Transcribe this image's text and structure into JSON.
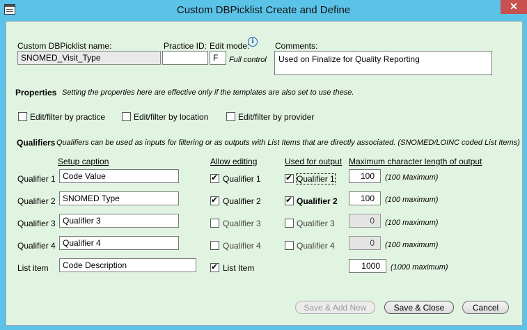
{
  "window": {
    "title": "Custom DBPicklist Create and Define",
    "close_label": "✕"
  },
  "header": {
    "name_label": "Custom DBPicklist name:",
    "name_value": "SNOMED_Visit_Type",
    "practice_label": "Practice ID:",
    "practice_value": "",
    "edit_mode_label": "Edit mode:",
    "edit_mode_value": "F",
    "edit_mode_desc": "Full control",
    "comments_label": "Comments:",
    "comments_value": "Used on Finalize for Quality Reporting"
  },
  "properties": {
    "heading": "Properties",
    "note": "Setting the properties here are effective only if the templates are also set to use these.",
    "options": [
      {
        "label": "Edit/filter by practice",
        "checked": false
      },
      {
        "label": "Edit/filter by location",
        "checked": false
      },
      {
        "label": "Edit/filter by provider",
        "checked": false
      }
    ]
  },
  "qualifiers": {
    "heading": "Qualifiers",
    "note": "Qualifiers can be used as inputs for filtering or as outputs with List Items that are directly associated. (SNOMED/LOINC coded List Items)",
    "col_caption": "Setup caption",
    "col_allow": "Allow editing",
    "col_used": "Used for output",
    "col_maxlen": "Maximum character length of output",
    "rows": [
      {
        "label": "Qualifier 1",
        "caption": "Code Value",
        "allow_label": "Qualifier 1",
        "allow_checked": true,
        "used_label": "Qualifier 1",
        "used_checked": true,
        "maxlen": "100",
        "max_note": "(100 Maximum)"
      },
      {
        "label": "Qualifier 2",
        "caption": "SNOMED Type",
        "allow_label": "Qualifier 2",
        "allow_checked": true,
        "used_label": "Qualifier 2",
        "used_checked": true,
        "maxlen": "100",
        "max_note": "(100 maximum)"
      },
      {
        "label": "Qualifier 3",
        "caption": "Qualifier 3",
        "allow_label": "Qualifier 3",
        "allow_checked": false,
        "used_label": "Qualifier 3",
        "used_checked": false,
        "maxlen": "0",
        "max_note": "(100 maximum)"
      },
      {
        "label": "Qualifier 4",
        "caption": "Qualifier 4",
        "allow_label": "Qualifier 4",
        "allow_checked": false,
        "used_label": "Qualifier 4",
        "used_checked": false,
        "maxlen": "0",
        "max_note": "(100 maximum)"
      }
    ],
    "list_item": {
      "label": "List item",
      "caption": "Code Description",
      "allow_label": "List Item",
      "allow_checked": true,
      "maxlen": "1000",
      "max_note": "(1000 maximum)"
    }
  },
  "buttons": {
    "save_add": "Save & Add New",
    "save_close": "Save & Close",
    "cancel": "Cancel"
  },
  "colors": {
    "titlebar": "#5bc3e8",
    "client_bg": "#e1f3e1",
    "close": "#c75050"
  }
}
